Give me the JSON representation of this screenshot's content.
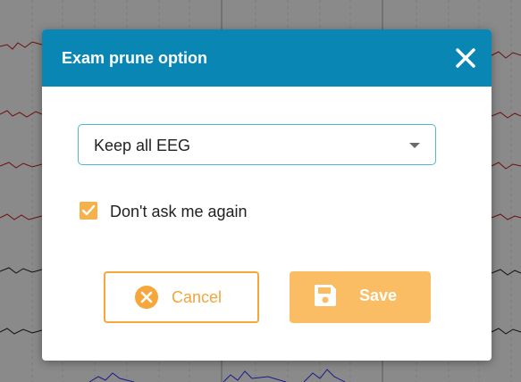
{
  "dialog": {
    "title": "Exam prune option",
    "close_icon": "close-icon"
  },
  "prune_select": {
    "selected": "Keep all EEG",
    "arrow_icon": "caret-down-icon"
  },
  "dont_ask": {
    "label": "Don't ask me again",
    "checked": true
  },
  "buttons": {
    "cancel_label": "Cancel",
    "cancel_icon": "cancel-circle-icon",
    "save_label": "Save",
    "save_icon": "floppy-disk-icon"
  },
  "colors": {
    "header": "#0a86b4",
    "accent": "#f5a73c",
    "save_bg": "#fbbd63",
    "select_border": "#4fb6e0"
  }
}
